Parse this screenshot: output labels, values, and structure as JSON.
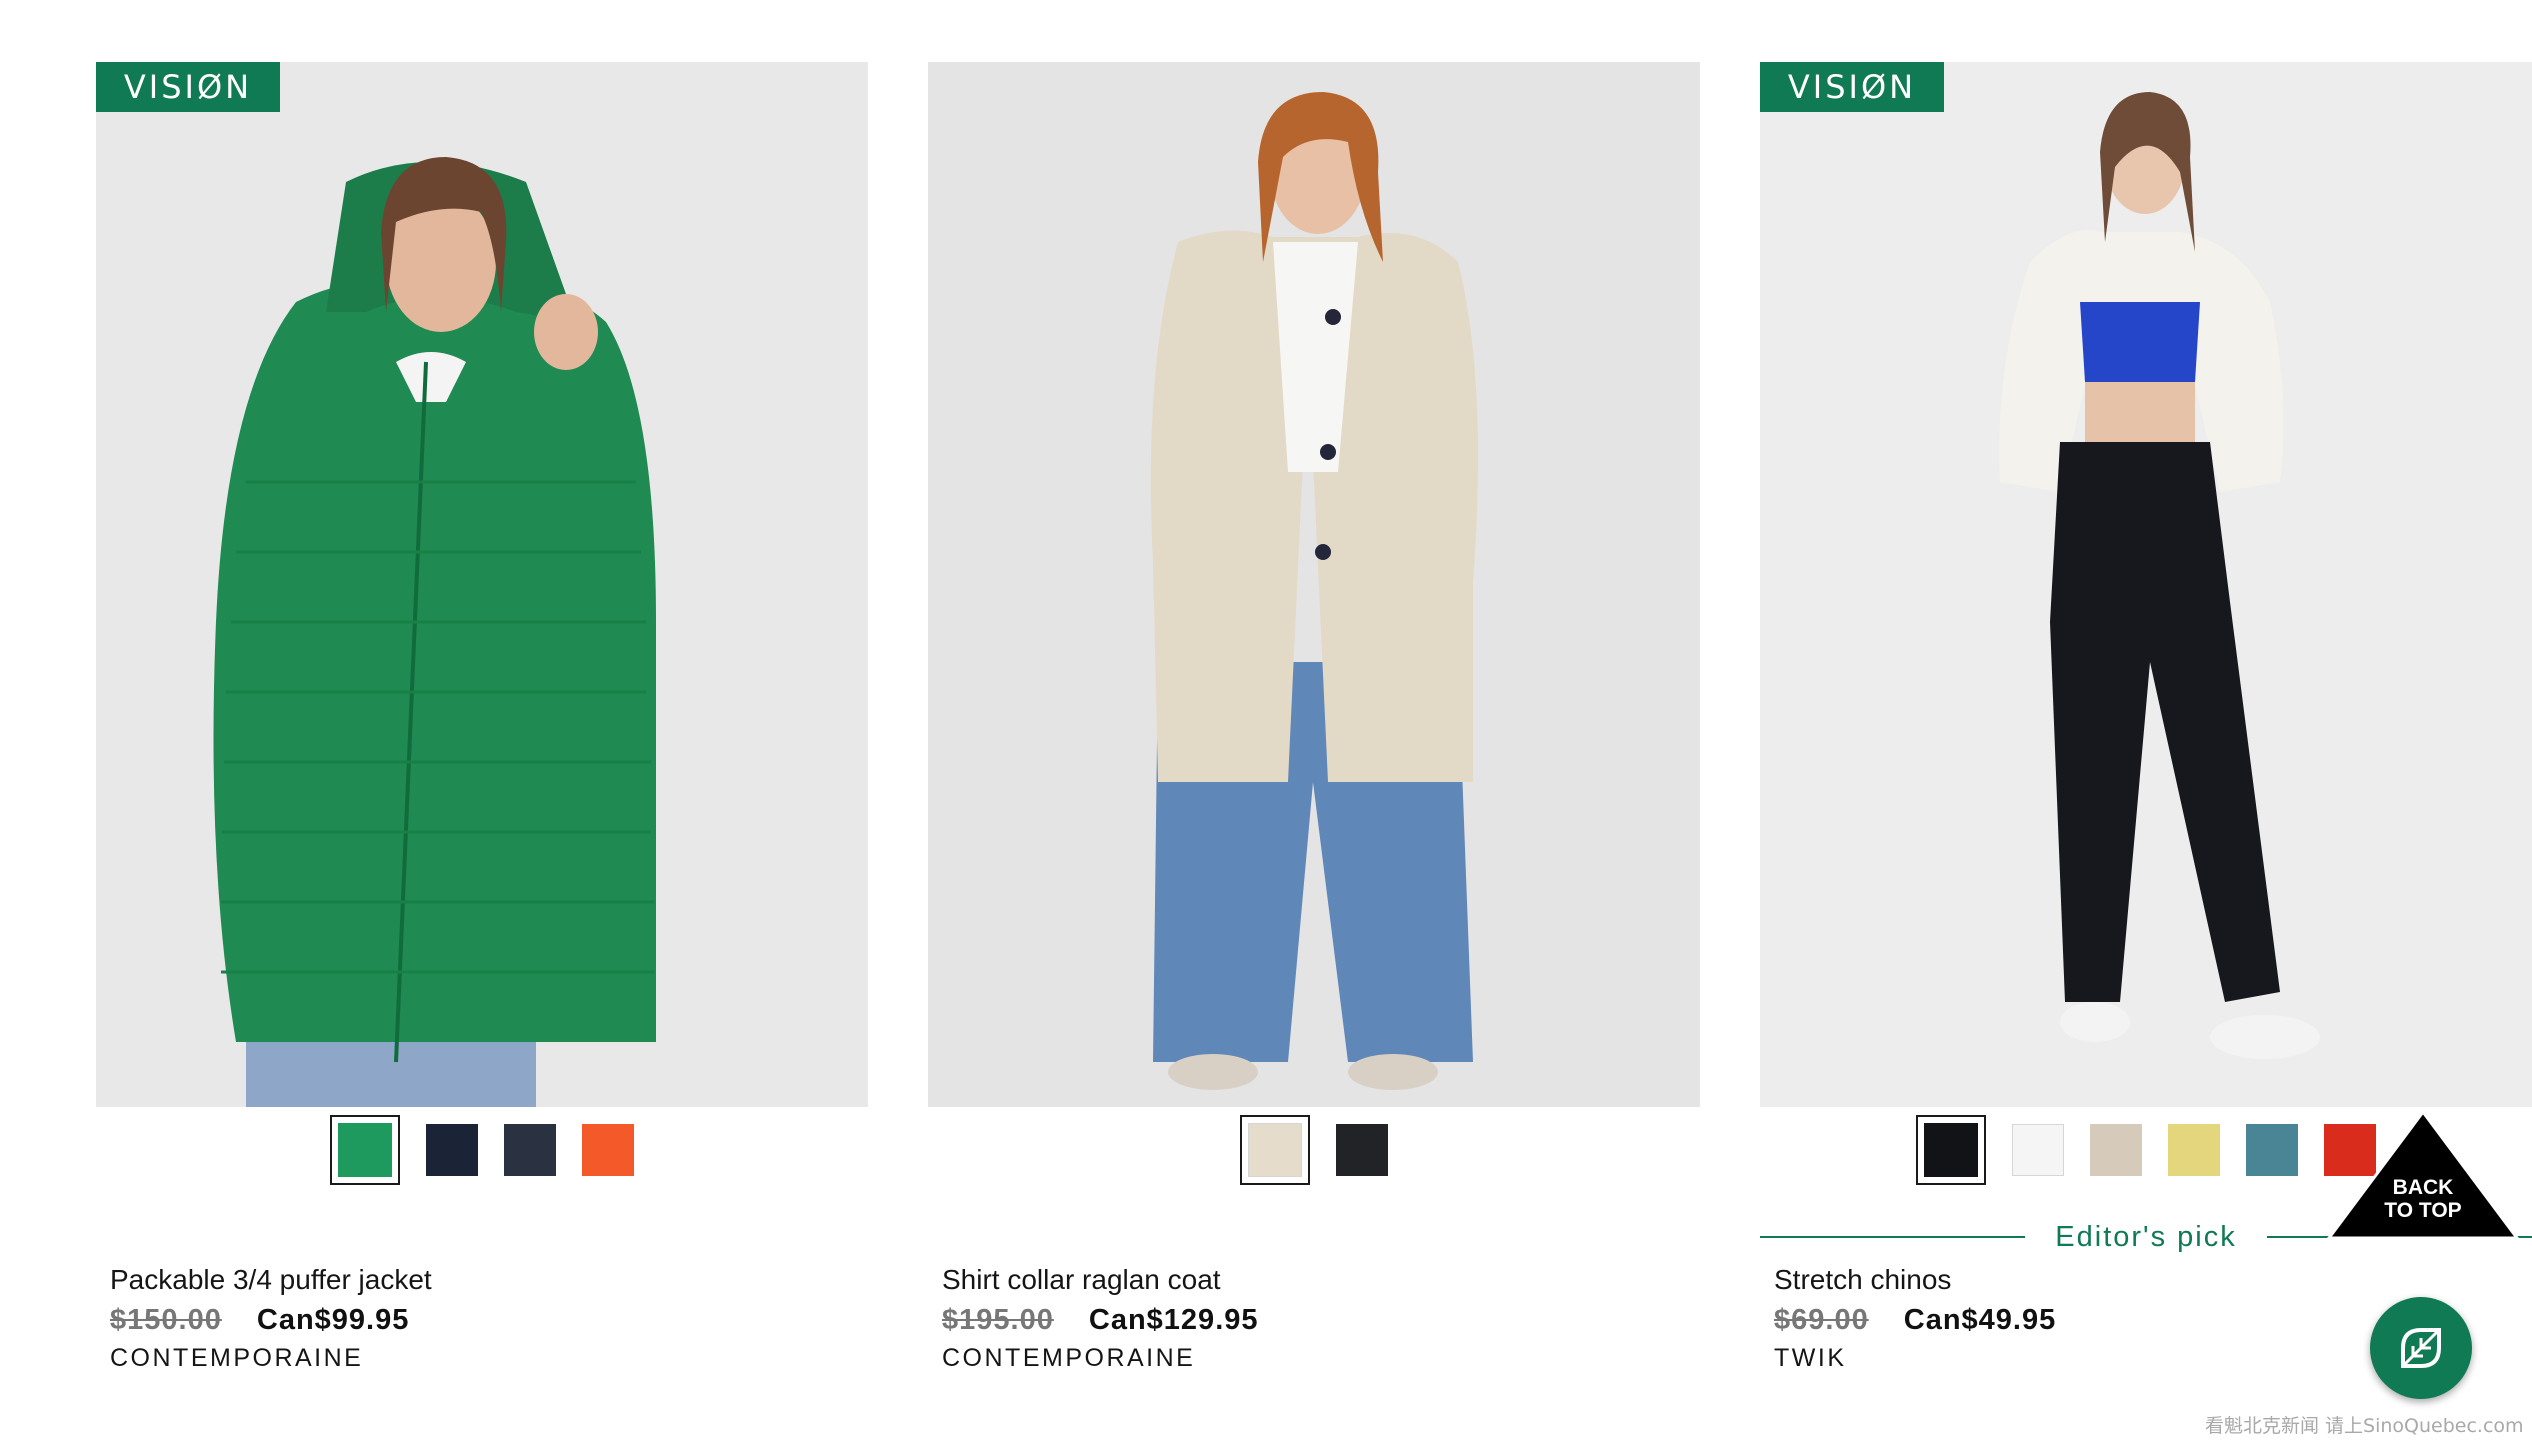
{
  "products": [
    {
      "badge": "VISIØN",
      "image_alt": "Woman wearing a green packable puffer jacket",
      "name": "Packable 3/4 puffer jacket",
      "old_price": "$150.00",
      "price": "Can$99.95",
      "brand": "CONTEMPORAINE",
      "swatches": [
        {
          "color": "#1f9a5e",
          "selected": true
        },
        {
          "color": "#1a2436",
          "selected": false
        },
        {
          "color": "#2a3141",
          "selected": false
        },
        {
          "color": "#f4592a",
          "selected": false
        }
      ]
    },
    {
      "image_alt": "Woman wearing a beige shirt collar raglan coat",
      "name": "Shirt collar raglan coat",
      "old_price": "$195.00",
      "price": "Can$129.95",
      "brand": "CONTEMPORAINE",
      "swatches": [
        {
          "color": "#e6dccb",
          "selected": true
        },
        {
          "color": "#222326",
          "selected": false
        }
      ]
    },
    {
      "badge": "VISIØN",
      "image_alt": "Woman wearing black stretch chinos",
      "editors_pick": "Editor's pick",
      "name": "Stretch chinos",
      "old_price": "$69.00",
      "price": "Can$49.95",
      "brand": "TWIK",
      "swatches": [
        {
          "color": "#121316",
          "selected": true
        },
        {
          "color": "#f5f5f5",
          "selected": false
        },
        {
          "color": "#d6cabb",
          "selected": false
        },
        {
          "color": "#e3d67d",
          "selected": false
        },
        {
          "color": "#4a8596",
          "selected": false
        },
        {
          "color": "#d92c1c",
          "selected": false
        }
      ]
    }
  ],
  "back_to_top": {
    "line1": "BACK",
    "line2": "TO TOP"
  },
  "chat_icon": "leaf-chat-icon",
  "watermark": "看魁北克新闻 请上SinoQuebec.com",
  "colors": {
    "brand_green": "#0f7a53"
  }
}
